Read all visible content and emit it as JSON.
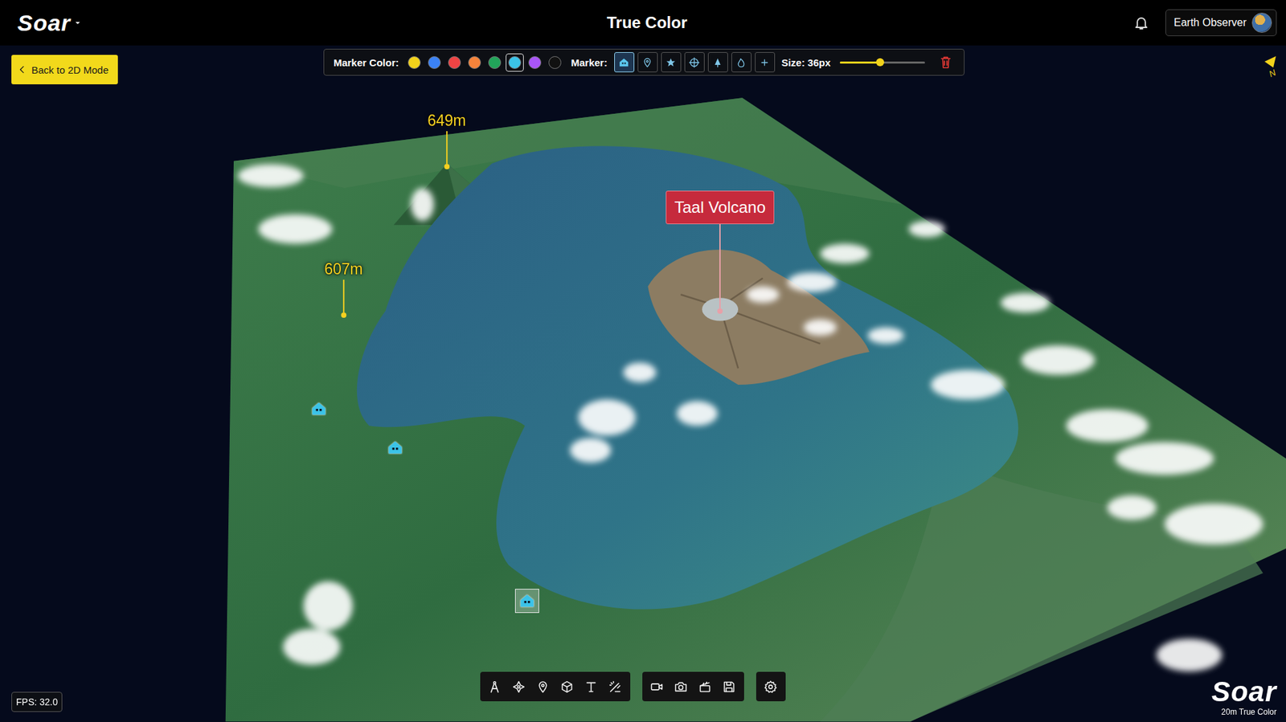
{
  "header": {
    "logo": "Soar",
    "title": "True Color",
    "user": "Earth Observer"
  },
  "back_button": {
    "label": "Back to 2D Mode"
  },
  "marker_toolbar": {
    "color_label": "Marker Color:",
    "colors": [
      {
        "color": "#f2d21b",
        "selected": false
      },
      {
        "color": "#3b82f6",
        "selected": false
      },
      {
        "color": "#ef4444",
        "selected": false
      },
      {
        "color": "#f5833b",
        "selected": false
      },
      {
        "color": "#22a55a",
        "selected": false
      },
      {
        "color": "#3bc3e8",
        "selected": true
      },
      {
        "color": "#a855f7",
        "selected": false
      },
      {
        "color": "#111111",
        "selected": false
      }
    ],
    "marker_label": "Marker:",
    "markers": [
      {
        "selected": true
      },
      {
        "selected": false
      },
      {
        "selected": false
      },
      {
        "selected": false
      },
      {
        "selected": false
      },
      {
        "selected": false
      },
      {
        "selected": false
      }
    ],
    "size_label": "Size: 36px",
    "size_level": 0.47
  },
  "compass": {
    "label": "N"
  },
  "map": {
    "pins": [
      {
        "label": "649m",
        "kind": "elevation",
        "color": "#f5d020"
      },
      {
        "label": "607m",
        "kind": "elevation",
        "color": "#f5d020"
      },
      {
        "label": "Taal Volcano",
        "kind": "place",
        "color": "#c62a3c"
      }
    ],
    "houses": [
      {
        "selected": false
      },
      {
        "selected": false
      },
      {
        "selected": true
      }
    ]
  },
  "fps": "FPS: 32.0",
  "watermark": {
    "logo": "Soar",
    "caption": "20m True Color"
  }
}
